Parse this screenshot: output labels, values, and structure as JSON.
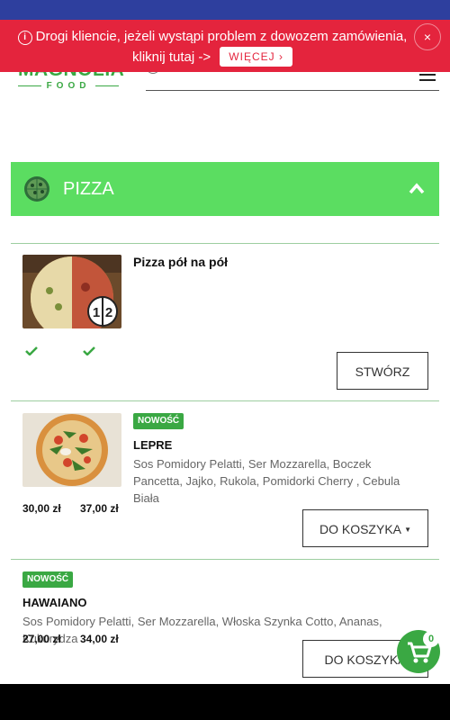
{
  "banner": {
    "message": "Drogi kliencie, jeżeli wystąpi problem z dowozem zamówienia, kliknij tutaj ->",
    "more_label": "WIĘCEJ",
    "close_label": "×"
  },
  "logo": {
    "main": "MAGNOLIA",
    "sub": "FOOD"
  },
  "category": {
    "title": "PIZZA"
  },
  "products": [
    {
      "name": "Pizza pół na pół",
      "button": "STWÓRZ",
      "half_marks": [
        "1",
        "2"
      ]
    },
    {
      "badge": "NOWOŚĆ",
      "name": "LEPRE",
      "description": "Sos Pomidory Pelatti, Ser Mozzarella, Boczek Pancetta, Jajko, Rukola, Pomidorki Cherry , Cebula Biała",
      "price_small": "30,00 zł",
      "price_large": "37,00 zł",
      "button": "DO KOSZYKA"
    },
    {
      "badge": "NOWOŚĆ",
      "name": "HAWAIANO",
      "description": "Sos Pomidory Pelatti, Ser Mozzarella, Włoska Szynka Cotto, Ananas, Kukurydza",
      "price_small": "27,00 zł",
      "price_large": "34,00 zł",
      "button": "DO KOSZYKA"
    }
  ],
  "cart": {
    "count": "0"
  },
  "colors": {
    "brand_green": "#3aa843",
    "category_green": "#5bdd61",
    "banner_red": "#e4243d",
    "topbar_blue": "#2e3f9e"
  }
}
